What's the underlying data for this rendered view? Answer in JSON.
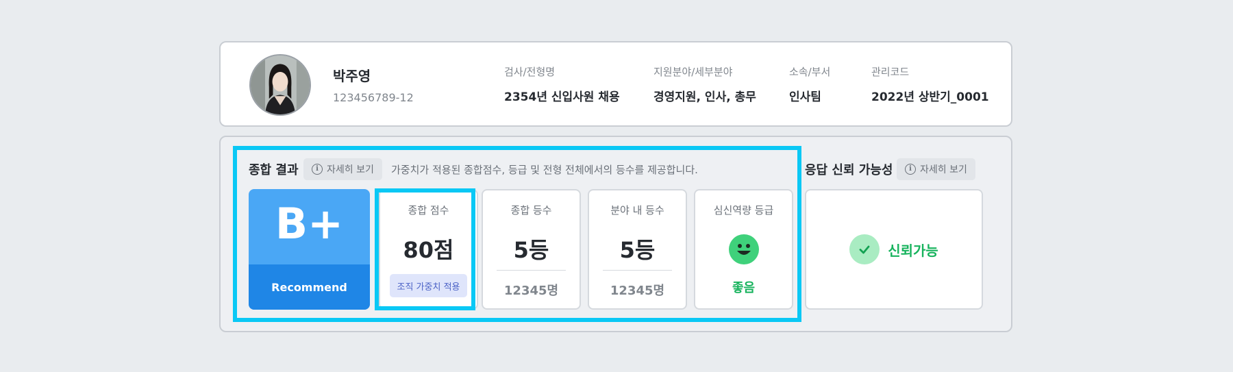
{
  "profile": {
    "name": "박주영",
    "id": "123456789-12",
    "fields": [
      {
        "label": "검사/전형명",
        "value": "2354년 신입사원 채용"
      },
      {
        "label": "지원분야/세부분야",
        "value": "경영지원, 인사, 총무"
      },
      {
        "label": "소속/부서",
        "value": "인사팀"
      },
      {
        "label": "관리코드",
        "value": "2022년 상반기_0001"
      }
    ]
  },
  "overall": {
    "title": "종합 결과",
    "detail_label": "자세히 보기",
    "description": "가중치가 적용된 종합점수, 등급 및 전형 전체에서의 등수를 제공합니다.",
    "grade": "B+",
    "grade_label": "Recommend",
    "score": {
      "label": "종합 점수",
      "value": "80점",
      "tag": "조직 가중치 적용"
    },
    "overall_rank": {
      "label": "종합 등수",
      "value": "5등",
      "total": "12345명"
    },
    "field_rank": {
      "label": "분야 내 등수",
      "value": "5등",
      "total": "12345명"
    },
    "mental": {
      "label": "심신역량 등급",
      "status": "좋음"
    }
  },
  "reliability": {
    "title": "응답 신뢰 가능성",
    "detail_label": "자세히 보기",
    "status": "신뢰가능"
  },
  "icons": {
    "info": "info-icon",
    "smile": "smile-face-icon",
    "check": "check-icon"
  },
  "colors": {
    "highlight": "#0ac8f5",
    "grade_top": "#4aa7f5",
    "grade_bottom": "#1f86e6",
    "good": "#17b35d"
  }
}
